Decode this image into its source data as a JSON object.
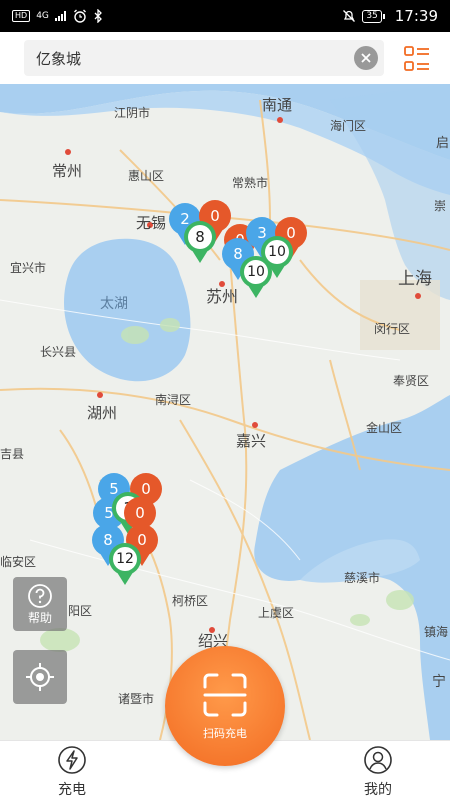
{
  "status_bar": {
    "hd_badge": "HD",
    "network": "4G",
    "battery": "35",
    "time": "17:39"
  },
  "search": {
    "value": "亿象城"
  },
  "map": {
    "cities": [
      "南通",
      "江阴市",
      "海门区",
      "启",
      "常州",
      "惠山区",
      "常熟市",
      "崇",
      "无锡",
      "宜兴市",
      "太湖",
      "苏州",
      "上海",
      "闵行区",
      "长兴县",
      "南浔区",
      "奉贤区",
      "湖州",
      "嘉兴",
      "金山区",
      "吉县",
      "临安区",
      "慈溪市",
      "阳区",
      "柯桥区",
      "上虞区",
      "镇海",
      "绍兴",
      "诸暨市",
      "宁"
    ],
    "markers": [
      {
        "label": "2",
        "color": "blue"
      },
      {
        "label": "0",
        "color": "orange"
      },
      {
        "label": "8",
        "color": "green"
      },
      {
        "label": "0",
        "color": "orange"
      },
      {
        "label": "8",
        "color": "blue"
      },
      {
        "label": "3",
        "color": "blue"
      },
      {
        "label": "0",
        "color": "orange"
      },
      {
        "label": "10",
        "color": "green"
      },
      {
        "label": "10",
        "color": "green"
      },
      {
        "label": "5",
        "color": "blue"
      },
      {
        "label": "0",
        "color": "orange"
      },
      {
        "label": "1",
        "color": "green"
      },
      {
        "label": "5",
        "color": "blue"
      },
      {
        "label": "0",
        "color": "orange"
      },
      {
        "label": "8",
        "color": "blue"
      },
      {
        "label": "0",
        "color": "orange"
      },
      {
        "label": "12",
        "color": "green"
      }
    ]
  },
  "help_label": "帮助",
  "scan_label": "扫码充电",
  "nav": {
    "charge_label": "充电",
    "mine_label": "我的"
  },
  "colors": {
    "accent": "#f26b22",
    "marker_blue": "#4aa6e8",
    "marker_green": "#3cb462",
    "marker_orange": "#e5582a",
    "water": "#a9cff0"
  }
}
